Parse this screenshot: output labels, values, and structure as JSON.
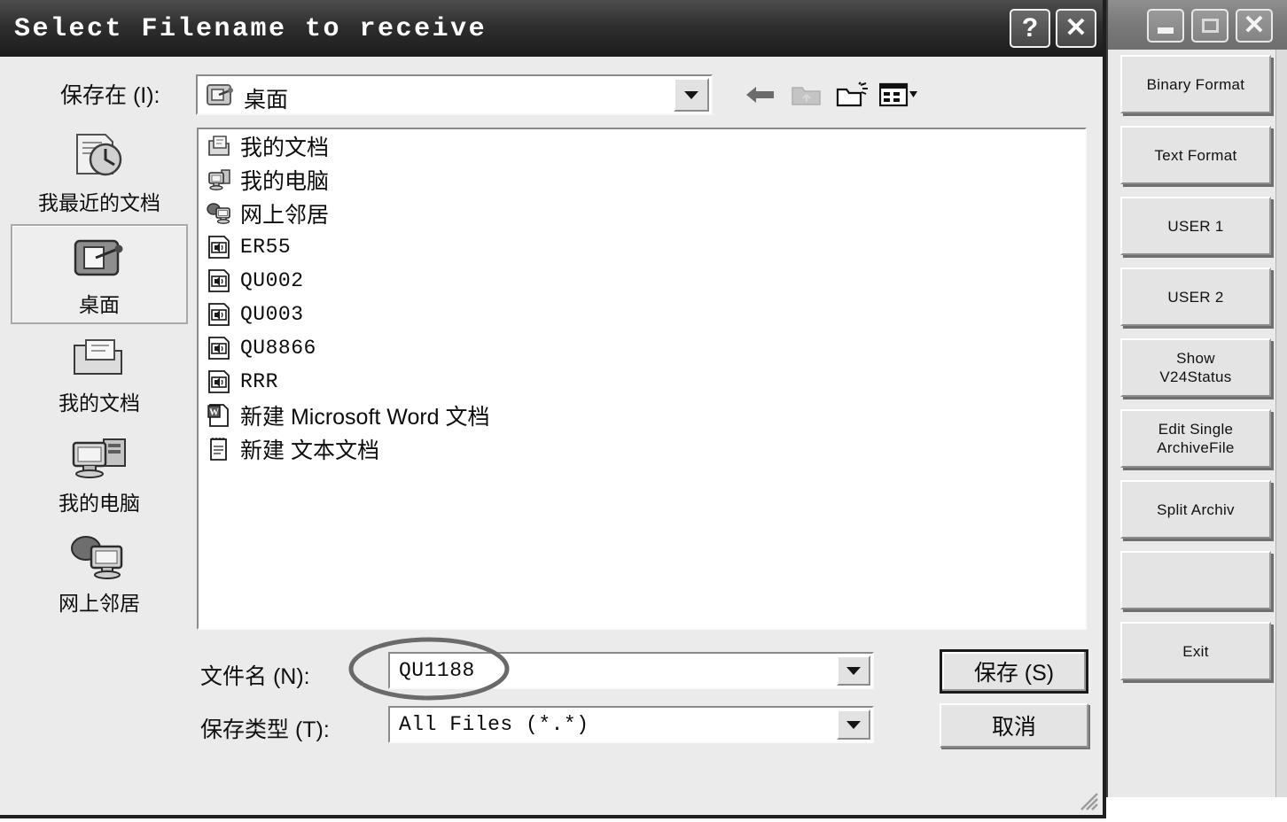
{
  "dialog": {
    "title": "Select Filename to receive",
    "titlebar_buttons": [
      {
        "name": "help-button",
        "glyph": "?"
      },
      {
        "name": "close-button",
        "glyph": "✕"
      }
    ],
    "save_in": {
      "label": "保存在 (I):",
      "value": "桌面",
      "icon": "desktop-icon"
    },
    "toolbar": [
      {
        "name": "back-icon",
        "label": "back"
      },
      {
        "name": "up-folder-icon",
        "label": "up one level",
        "disabled": true
      },
      {
        "name": "new-folder-icon",
        "label": "create new folder"
      },
      {
        "name": "views-icon",
        "label": "views"
      }
    ],
    "places": [
      {
        "label": "我最近的文档",
        "icon": "recent-documents-icon",
        "selected": false
      },
      {
        "label": "桌面",
        "icon": "desktop-icon",
        "selected": true
      },
      {
        "label": "我的文档",
        "icon": "my-documents-icon",
        "selected": false
      },
      {
        "label": "我的电脑",
        "icon": "my-computer-icon",
        "selected": false
      },
      {
        "label": "网上邻居",
        "icon": "network-places-icon",
        "selected": false
      }
    ],
    "files": [
      {
        "name": "我的文档",
        "icon": "my-documents-icon",
        "mono": false
      },
      {
        "name": "我的电脑",
        "icon": "my-computer-icon",
        "mono": false
      },
      {
        "name": "网上邻居",
        "icon": "network-places-icon",
        "mono": false
      },
      {
        "name": "ER55",
        "icon": "sound-file-icon",
        "mono": true
      },
      {
        "name": "QU002",
        "icon": "sound-file-icon",
        "mono": true
      },
      {
        "name": "QU003",
        "icon": "sound-file-icon",
        "mono": true
      },
      {
        "name": "QU8866",
        "icon": "sound-file-icon",
        "mono": true
      },
      {
        "name": "RRR",
        "icon": "sound-file-icon",
        "mono": true
      },
      {
        "name": "新建 Microsoft Word 文档",
        "icon": "word-document-icon",
        "mono": false
      },
      {
        "name": "新建 文本文档",
        "icon": "text-document-icon",
        "mono": false
      }
    ],
    "filename_field": {
      "label": "文件名 (N):",
      "value": "QU1188",
      "annotated": true
    },
    "filetype_field": {
      "label": "保存类型 (T):",
      "value": "All Files (*.*)"
    },
    "save_button": "保存 (S)",
    "cancel_button": "取消"
  },
  "parent_window": {
    "titlebar_buttons": [
      {
        "name": "minimize-button",
        "glyph": "minimize"
      },
      {
        "name": "maximize-button",
        "glyph": "maximize"
      },
      {
        "name": "close-button",
        "glyph": "✕"
      }
    ],
    "buttons": [
      {
        "label": "Binary Format"
      },
      {
        "label": "Text Format"
      },
      {
        "label": "USER 1"
      },
      {
        "label": "USER 2"
      },
      {
        "label": "Show\nV24Status"
      },
      {
        "label": "Edit Single\nArchiveFile"
      },
      {
        "label": "Split Archiv"
      },
      {
        "label": ""
      },
      {
        "label": "Exit"
      }
    ]
  },
  "colors": {
    "dialog_face": "#ebebeb",
    "titlebar_dark": "#2f2f2f",
    "field_white": "#ffffff",
    "button_face": "#e4e4e4",
    "annotation": "#6a6a6a"
  }
}
